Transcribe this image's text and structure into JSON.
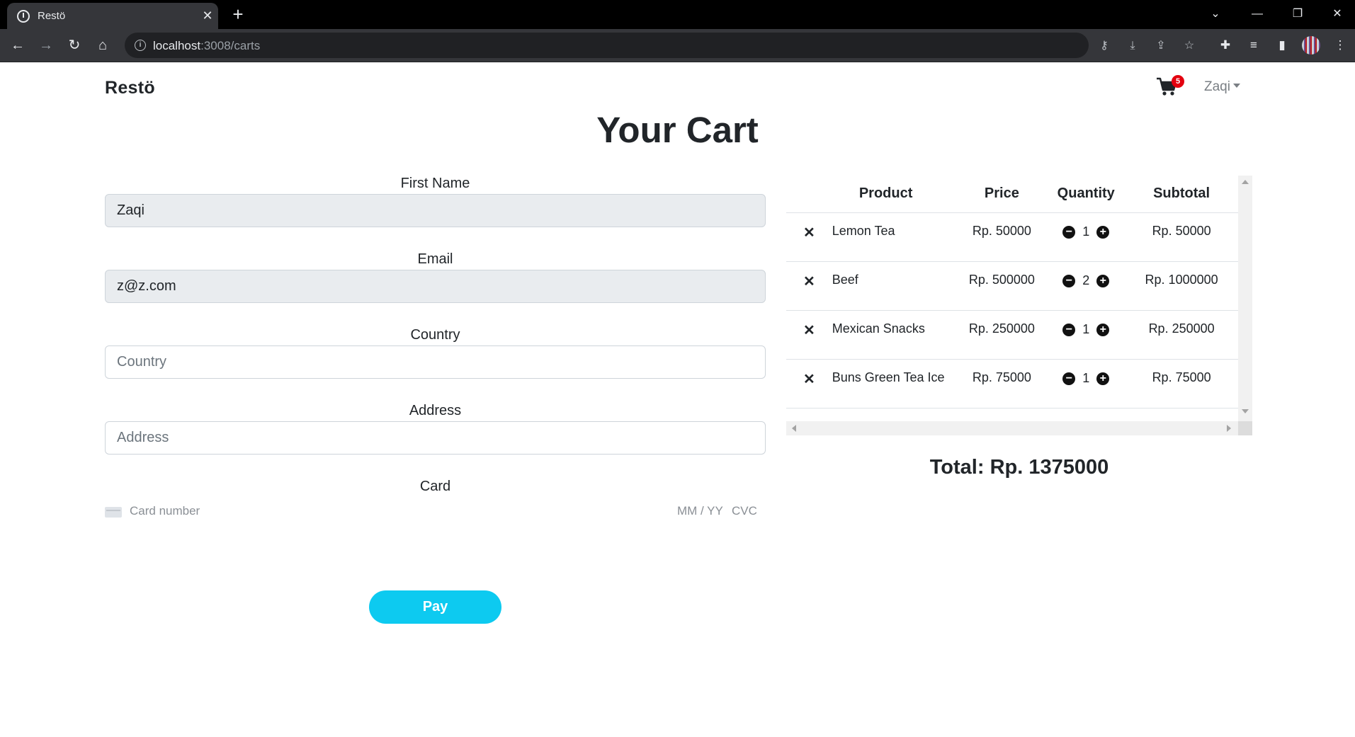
{
  "browser": {
    "tab_title": "Restö",
    "url_host": "localhost",
    "url_path": ":3008/carts",
    "new_tab_symbol": "+",
    "tab_close_symbol": "✕"
  },
  "navbar": {
    "brand": "Restö",
    "cart_count": "5",
    "user_name": "Zaqi"
  },
  "page": {
    "title": "Your Cart"
  },
  "form": {
    "first_name_label": "First Name",
    "first_name_value": "Zaqi",
    "email_label": "Email",
    "email_value": "z@z.com",
    "country_label": "Country",
    "country_placeholder": "Country",
    "address_label": "Address",
    "address_placeholder": "Address",
    "card_label": "Card",
    "card_number_placeholder": "Card number",
    "card_expiry_placeholder": "MM / YY",
    "card_cvc_placeholder": "CVC",
    "pay_label": "Pay"
  },
  "cart": {
    "columns": {
      "product": "Product",
      "price": "Price",
      "quantity": "Quantity",
      "subtotal": "Subtotal"
    },
    "remove_symbol": "✕",
    "decrease_symbol": "−",
    "increase_symbol": "+",
    "items": [
      {
        "product": "Lemon Tea",
        "price": "Rp. 50000",
        "quantity": "1",
        "subtotal": "Rp. 50000"
      },
      {
        "product": "Beef",
        "price": "Rp. 500000",
        "quantity": "2",
        "subtotal": "Rp. 1000000"
      },
      {
        "product": "Mexican Snacks",
        "price": "Rp. 250000",
        "quantity": "1",
        "subtotal": "Rp. 250000"
      },
      {
        "product": "Buns Green Tea Ice",
        "price": "Rp. 75000",
        "quantity": "1",
        "subtotal": "Rp. 75000"
      }
    ],
    "total": "Total: Rp. 1375000"
  },
  "colors": {
    "accent": "#0dcaf0",
    "badge": "#e3000f",
    "readonly_input_bg": "#e9ecef"
  }
}
